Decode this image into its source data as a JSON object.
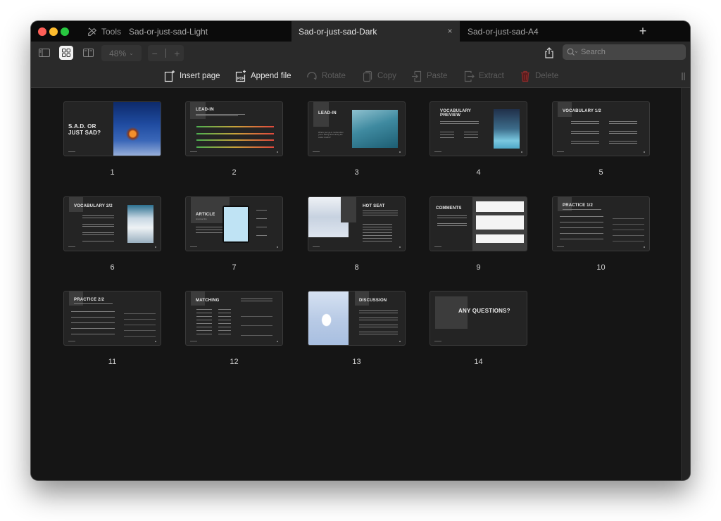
{
  "window": {
    "tools_label": "Tools",
    "tabs": [
      {
        "label": "Sad-or-just-sad-Light",
        "active": false
      },
      {
        "label": "Sad-or-just-sad-Dark",
        "active": true,
        "close": "×"
      },
      {
        "label": "Sad-or-just-sad-A4",
        "active": false
      }
    ],
    "new_tab": "+"
  },
  "toolbar": {
    "view_modes": [
      "sidebar-view",
      "grid-view",
      "spread-view"
    ],
    "active_view": "grid-view",
    "zoom_level": "48%",
    "zoom_out": "−",
    "zoom_in": "+",
    "search_placeholder": "Search"
  },
  "actions": [
    {
      "label": "Insert page",
      "icon": "insert-page-icon",
      "enabled": true
    },
    {
      "label": "Append file",
      "icon": "append-pdf-icon",
      "enabled": true
    },
    {
      "label": "Rotate",
      "icon": "rotate-icon",
      "enabled": false
    },
    {
      "label": "Copy",
      "icon": "copy-icon",
      "enabled": false
    },
    {
      "label": "Paste",
      "icon": "paste-icon",
      "enabled": false
    },
    {
      "label": "Extract",
      "icon": "extract-icon",
      "enabled": false
    },
    {
      "label": "Delete",
      "icon": "trash-icon",
      "enabled": false
    }
  ],
  "colors": {
    "delete_icon": "#8b2a2a",
    "window_bg": "#151515",
    "toolbar_bg": "#2a2a2a"
  },
  "pages": [
    {
      "number": "1",
      "title": "S.A.D. OR JUST SAD?"
    },
    {
      "number": "2",
      "title": "LEAD-IN"
    },
    {
      "number": "3",
      "title": "LEAD-IN",
      "text": "What's your go-to routine when you're feeling down during the colder months?"
    },
    {
      "number": "4",
      "title": "VOCABULARY PREVIEW"
    },
    {
      "number": "5",
      "title": "VOCABULARY 1/2"
    },
    {
      "number": "6",
      "title": "VOCABULARY 2/2"
    },
    {
      "number": "7",
      "title": "ARTICLE",
      "subtitle": "download link"
    },
    {
      "number": "8",
      "title": "HOT SEAT"
    },
    {
      "number": "9",
      "title": "COMMENTS"
    },
    {
      "number": "10",
      "title": "PRACTICE 1/2"
    },
    {
      "number": "11",
      "title": "PRACTICE 2/2"
    },
    {
      "number": "12",
      "title": "MATCHING"
    },
    {
      "number": "13",
      "title": "DISCUSSION"
    },
    {
      "number": "14",
      "title": "ANY QUESTIONS?"
    }
  ]
}
